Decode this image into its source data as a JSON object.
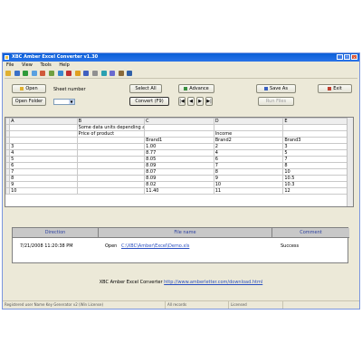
{
  "window": {
    "title": "XBC Amber Excel Converter v1.30",
    "menu": [
      "File",
      "View",
      "Tools",
      "Help"
    ]
  },
  "toolbar_icons": [
    "open-icon",
    "save-icon",
    "excel-icon",
    "refresh-icon",
    "undo-icon",
    "back-icon",
    "forward-icon",
    "stop-icon",
    "home-icon",
    "help-icon",
    "settings-icon",
    "info-icon",
    "zoom-icon",
    "print-icon",
    "close-icon"
  ],
  "panel": {
    "open_label": "Open",
    "sheet_label": "Sheet number",
    "open_folder_label": "Open Folder",
    "select_all_label": "Select All",
    "advance_label": "Advance",
    "save_label": "Save As",
    "convert_label": "Convert (F9)",
    "exit_label": "Exit",
    "disabled_label": "Run Files"
  },
  "grid": {
    "columns": [
      "A",
      "B",
      "C",
      "D",
      "E"
    ],
    "rows": [
      [
        "",
        "Some data units depending at",
        "",
        "",
        ""
      ],
      [
        "",
        "Price of product",
        "",
        "Income",
        ""
      ],
      [
        "",
        "",
        "Brand1",
        "Brand2",
        "Brand3"
      ],
      [
        "3",
        "",
        "1.00",
        "2",
        "3"
      ],
      [
        "4",
        "",
        "8.77",
        "4",
        "5"
      ],
      [
        "5",
        "",
        "8.05",
        "6",
        "7"
      ],
      [
        "6",
        "",
        "8.09",
        "7",
        "8"
      ],
      [
        "7",
        "",
        "8.07",
        "8",
        "10"
      ],
      [
        "8",
        "",
        "8.09",
        "9",
        "10.5"
      ],
      [
        "9",
        "",
        "8.02",
        "10",
        "10.3"
      ],
      [
        "10",
        "",
        "11.40",
        "11",
        "12"
      ]
    ]
  },
  "log": {
    "col_direction": "Direction",
    "col_file": "File name",
    "col_comment": "Comment",
    "row_date": "7/21/2008 11:20:38 PM",
    "row_action": "Open",
    "row_file": "C:\\XBC\\Amber\\Excel\\Demo.xls",
    "row_comment": "Success"
  },
  "footer": {
    "prefix": "XBC Amber Excel Converter",
    "link": "http://www.amberletter.com/download.html"
  },
  "statusbar": {
    "hint": "Registered user Name Key Generator v2 (Win License)",
    "cell2": "All records",
    "cell3": "Licensed"
  }
}
